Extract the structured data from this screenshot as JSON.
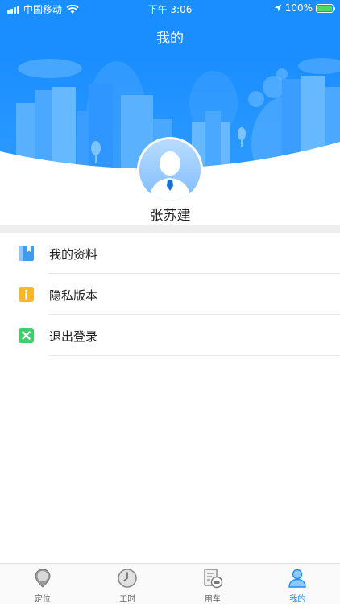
{
  "status_bar": {
    "carrier": "中国移动",
    "time": "下午 3:06",
    "battery": "100%"
  },
  "header": {
    "title": "我的"
  },
  "profile": {
    "name": "张苏建"
  },
  "menu": {
    "items": [
      {
        "label": "我的资料",
        "icon": "profile-book-icon",
        "color": "#3d9bf0"
      },
      {
        "label": "隐私版本",
        "icon": "info-icon",
        "color": "#f8b62b"
      },
      {
        "label": "退出登录",
        "icon": "close-x-icon",
        "color": "#3ccf6a"
      }
    ]
  },
  "tabbar": {
    "items": [
      {
        "label": "定位",
        "icon": "location-pin-icon"
      },
      {
        "label": "工时",
        "icon": "clock-icon"
      },
      {
        "label": "用车",
        "icon": "car-document-icon"
      },
      {
        "label": "我的",
        "icon": "user-icon",
        "active": true
      }
    ]
  },
  "colors": {
    "brand": "#1a8dff",
    "tab_inactive": "#666666",
    "divider": "#eeeeee"
  }
}
